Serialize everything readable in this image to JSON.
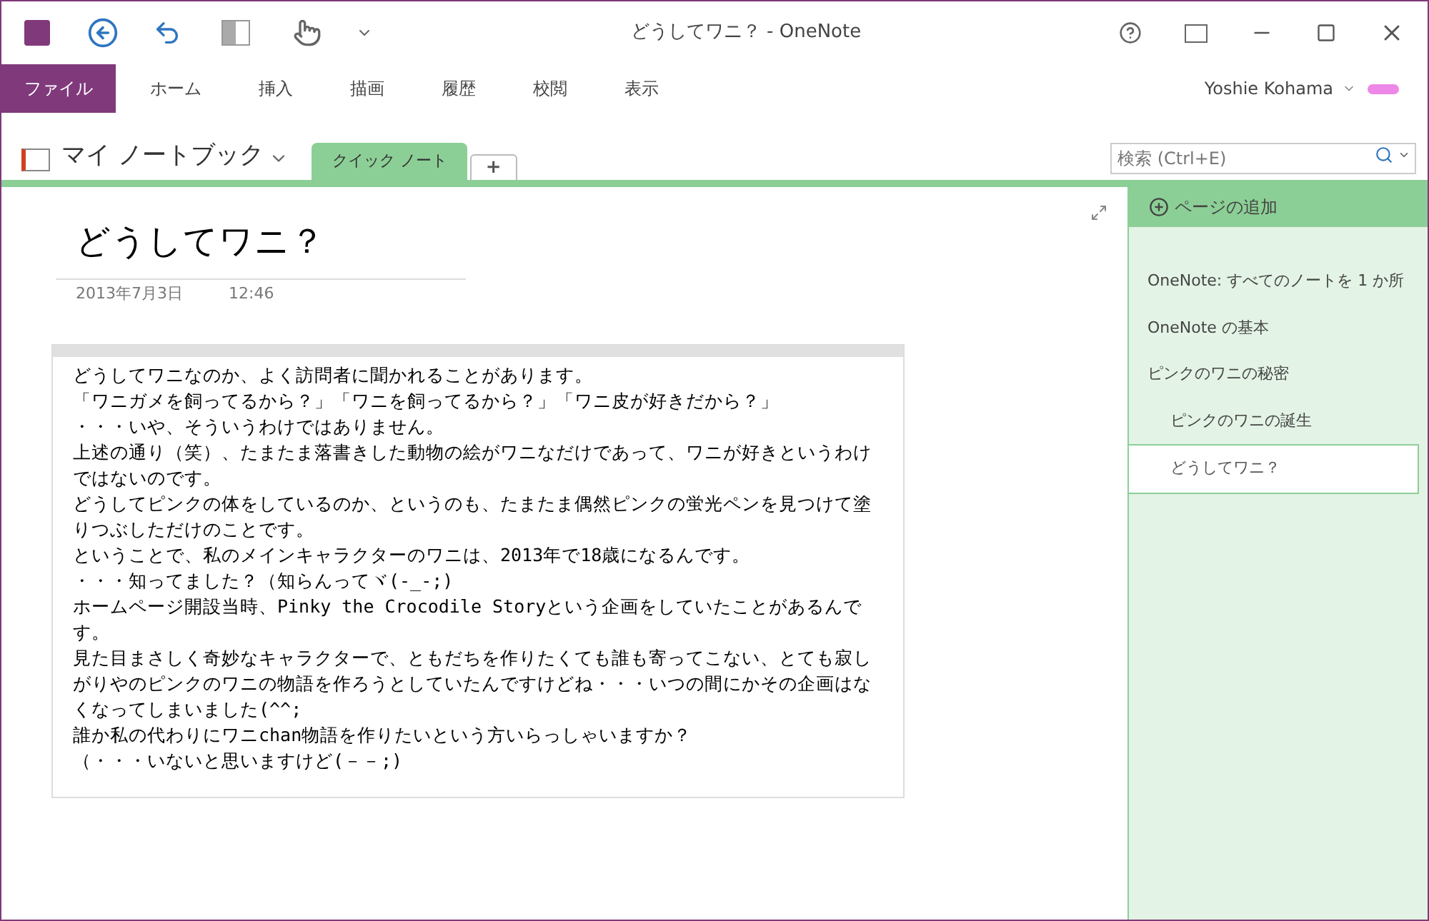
{
  "window": {
    "title": "どうしてワニ？ - OneNote"
  },
  "ribbon_tabs": [
    {
      "label": "ファイル",
      "selected": true
    },
    {
      "label": "ホーム",
      "selected": false
    },
    {
      "label": "挿入",
      "selected": false
    },
    {
      "label": "描画",
      "selected": false
    },
    {
      "label": "履歴",
      "selected": false
    },
    {
      "label": "校閲",
      "selected": false
    },
    {
      "label": "表示",
      "selected": false
    }
  ],
  "user": {
    "name": "Yoshie Kohama"
  },
  "notebook": {
    "name": "マイ ノートブック"
  },
  "section_tabs": [
    {
      "label": "クイック ノート",
      "selected": true
    }
  ],
  "add_section": "+",
  "search": {
    "placeholder": "検索 (Ctrl+E)"
  },
  "page": {
    "title": "どうしてワニ？",
    "date": "2013年7月3日",
    "time": "12:46",
    "paragraphs": [
      "どうしてワニなのか、よく訪問者に聞かれることがあります。",
      "「ワニガメを飼ってるから？」「ワニを飼ってるから？」「ワニ皮が好きだから？」",
      "・・・いや、そういうわけではありません。",
      "上述の通り（笑）、たまたま落書きした動物の絵がワニなだけであって、ワニが好きというわけではないのです。",
      "どうしてピンクの体をしているのか、というのも、たまたま偶然ピンクの蛍光ペンを見つけて塗りつぶしただけのことです。",
      "ということで、私のメインキャラクターのワニは、2013年で18歳になるんです。",
      "・・・知ってました？（知らんってヾ(-_-;)",
      "ホームページ開設当時、Pinky the Crocodile Storyという企画をしていたことがあるんです。",
      "見た目まさしく奇妙なキャラクターで、ともだちを作りたくても誰も寄ってこない、とても寂しがりやのピンクのワニの物語を作ろうとしていたんですけどね・・・いつの間にかその企画はなくなってしまいました(^^;",
      "誰か私の代わりにワニchan物語を作りたいという方いらっしゃいますか？",
      "（・・・いないと思いますけど(－－;)"
    ]
  },
  "pages_pane": {
    "add_page": "ページの追加",
    "pages": [
      {
        "title": "OneNote: すべてのノートを 1 か所",
        "selected": false
      },
      {
        "title": "OneNote の基本",
        "selected": false
      },
      {
        "title": "ピンクのワニの秘密",
        "selected": false,
        "children": [
          {
            "title": "ピンクのワニの誕生",
            "selected": false
          },
          {
            "title": "どうしてワニ？",
            "selected": true
          }
        ]
      }
    ]
  }
}
